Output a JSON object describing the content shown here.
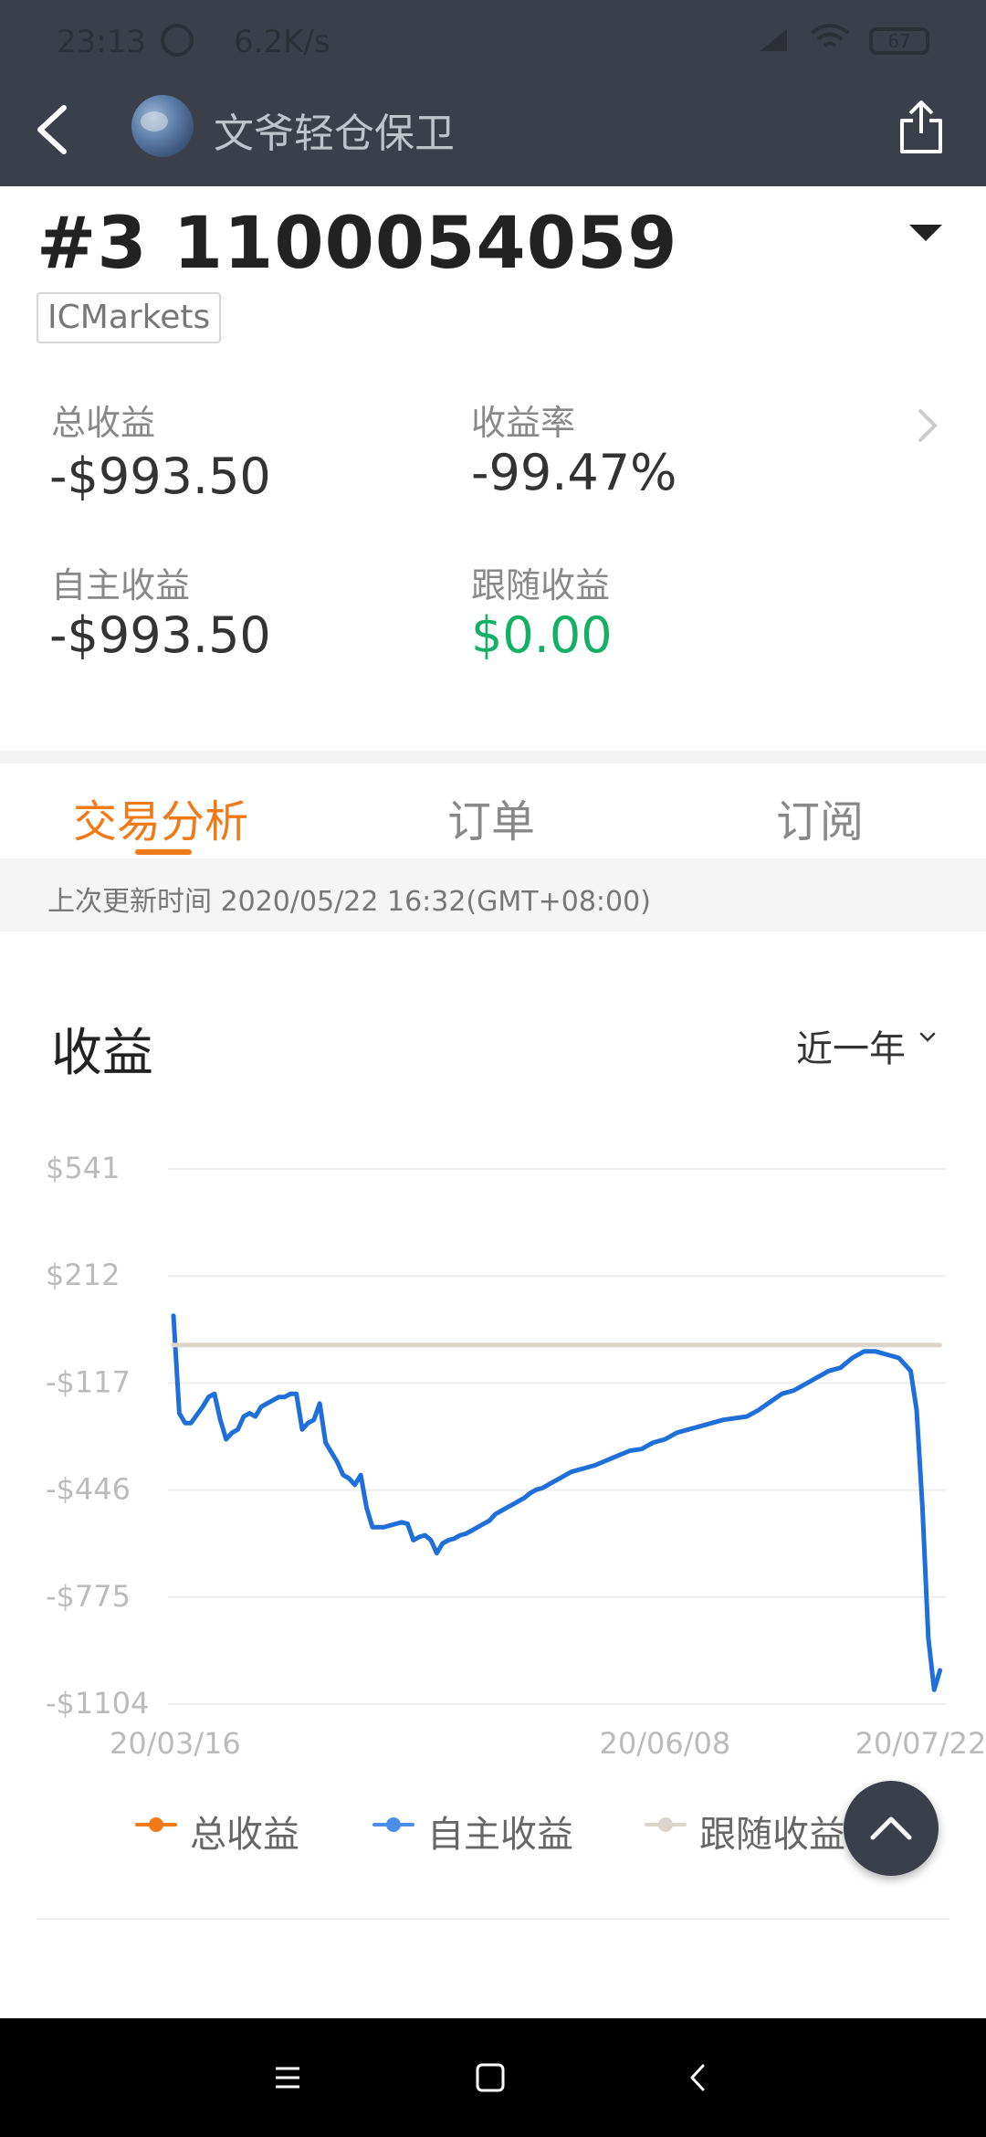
{
  "status_bar": {
    "time": "23:13",
    "speed": "6.2K/s",
    "battery": "67"
  },
  "header": {
    "title": "文爷轻仓保卫"
  },
  "account": {
    "title": "#3 1100054059",
    "broker": "ICMarkets"
  },
  "stats": {
    "total_label": "总收益",
    "total_value": "-$993.50",
    "rate_label": "收益率",
    "rate_value": "-99.47%",
    "own_label": "自主收益",
    "own_value": "-$993.50",
    "follow_label": "跟随收益",
    "follow_value": "$0.00"
  },
  "tabs": [
    {
      "label": "交易分析",
      "active": true
    },
    {
      "label": "订单",
      "active": false
    },
    {
      "label": "订阅",
      "active": false
    }
  ],
  "update_time": "上次更新时间 2020/05/22 16:32(GMT+08:00)",
  "chart_section": {
    "title": "收益",
    "period": "近一年"
  },
  "chart_data": {
    "type": "line",
    "title": "收益",
    "xlabel": "",
    "ylabel": "",
    "y_tick_labels": [
      "$541",
      "$212",
      "-$117",
      "-$446",
      "-$775",
      "-$1104"
    ],
    "y_ticks": [
      541,
      212,
      -117,
      -446,
      -775,
      -1104
    ],
    "x_tick_labels": [
      "20/03/16",
      "20/06/08",
      "20/07/22"
    ],
    "x_tick_positions": [
      0,
      84,
      128
    ],
    "ylim": [
      -1104,
      541
    ],
    "xlim": [
      0,
      132
    ],
    "grid": true,
    "legend_position": "bottom",
    "colors": {
      "总收益": "#f07a17",
      "自主收益": "#1e6fd9",
      "跟随收益": "#ddd5cc"
    },
    "series": [
      {
        "name": "自主收益",
        "x": [
          0,
          1,
          2,
          3,
          5,
          6,
          7,
          8,
          9,
          10,
          11,
          12,
          13,
          14,
          15,
          16,
          17,
          18,
          19,
          20,
          21,
          22,
          23,
          24,
          25,
          26,
          27,
          28,
          29,
          30,
          31,
          32,
          33,
          34,
          35,
          36,
          37,
          38,
          39,
          40,
          41,
          42,
          43,
          44,
          45,
          46,
          47,
          48,
          49,
          50,
          51,
          52,
          53,
          54,
          55,
          56,
          57,
          58,
          59,
          60,
          61,
          62,
          63,
          64,
          65,
          66,
          67,
          68,
          69,
          70,
          72,
          74,
          76,
          78,
          80,
          82,
          84,
          86,
          88,
          90,
          92,
          94,
          96,
          98,
          100,
          102,
          104,
          106,
          108,
          110,
          112,
          114,
          116,
          118,
          120,
          122,
          124,
          126,
          127,
          128,
          129,
          130,
          131
        ],
        "y": [
          90,
          -210,
          -240,
          -240,
          -190,
          -160,
          -150,
          -230,
          -290,
          -270,
          -260,
          -220,
          -210,
          -220,
          -190,
          -180,
          -170,
          -160,
          -160,
          -150,
          -150,
          -260,
          -240,
          -230,
          -180,
          -300,
          -330,
          -360,
          -400,
          -410,
          -430,
          -400,
          -500,
          -560,
          -560,
          -560,
          -555,
          -550,
          -545,
          -550,
          -600,
          -590,
          -585,
          -600,
          -640,
          -610,
          -600,
          -595,
          -585,
          -580,
          -570,
          -560,
          -550,
          -540,
          -520,
          -510,
          -500,
          -490,
          -480,
          -470,
          -455,
          -445,
          -440,
          -430,
          -420,
          -410,
          -400,
          -390,
          -385,
          -380,
          -370,
          -355,
          -340,
          -325,
          -320,
          -300,
          -290,
          -270,
          -260,
          -250,
          -240,
          -230,
          -225,
          -220,
          -200,
          -175,
          -150,
          -140,
          -120,
          -100,
          -80,
          -70,
          -40,
          -20,
          -20,
          -30,
          -40,
          -80,
          -200,
          -500,
          -900,
          -1060,
          -1000
        ]
      },
      {
        "name": "跟随收益",
        "x": [
          0,
          131
        ],
        "y": [
          0,
          0
        ]
      }
    ],
    "legend": [
      "总收益",
      "自主收益",
      "跟随收益"
    ]
  },
  "legend_labels": {
    "total": "总收益",
    "own": "自主收益",
    "follow": "跟随收益"
  }
}
